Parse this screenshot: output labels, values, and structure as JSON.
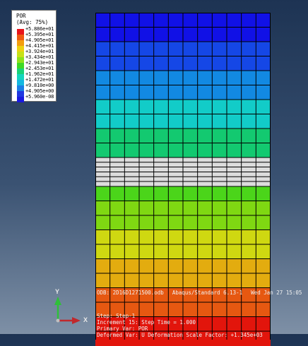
{
  "legend": {
    "title": "POR",
    "subtitle": "(Avg: 75%)",
    "entries": [
      {
        "label": "+5.886e+01",
        "color": "#e8141b"
      },
      {
        "label": "+5.395e+01",
        "color": "#ef5a12"
      },
      {
        "label": "+4.905e+01",
        "color": "#f39e0e"
      },
      {
        "label": "+4.415e+01",
        "color": "#ecd211"
      },
      {
        "label": "+3.924e+01",
        "color": "#c8e116"
      },
      {
        "label": "+3.434e+01",
        "color": "#8ee21b"
      },
      {
        "label": "+2.943e+01",
        "color": "#3ed924"
      },
      {
        "label": "+2.453e+01",
        "color": "#19d278"
      },
      {
        "label": "+1.962e+01",
        "color": "#14d5bd"
      },
      {
        "label": "+1.472e+01",
        "color": "#14b8e0"
      },
      {
        "label": "+9.810e+00",
        "color": "#1b7fe6"
      },
      {
        "label": "+4.905e+00",
        "color": "#1f38e0"
      },
      {
        "label": "+5.960e-08",
        "color": "#1a1adf"
      }
    ]
  },
  "contour": {
    "band_colors": [
      "#1111e6",
      "#1111e6",
      "#1547e6",
      "#1547e6",
      "#1289e2",
      "#1289e2",
      "#12ccc8",
      "#12ccc8",
      "#13c970",
      "#13c970",
      "#dcdcdc",
      "#dcdcdc",
      "#4bd51a",
      "#7fd812",
      "#7fd812",
      "#cfd811",
      "#cfd811",
      "#e3ac0f",
      "#e3ac0f",
      "#e65811",
      "#e65811",
      "#e2150c",
      "#e2150c"
    ],
    "columns": 12
  },
  "info": {
    "odb_file": "ODB: 2D16D1271500.odb",
    "solver": "Abaqus/Standard 6.13-1",
    "date": "Wed Jan 27 15:05",
    "step_line": "Step: Step-1",
    "increment_line": "Increment    15: Step Time =    1.000",
    "primary_var_line": "Primary Var: POR",
    "deformed_line": "Deformed Var: U   Deformation Scale Factor: +1.345e+03"
  },
  "triad": {
    "x_label": "X",
    "y_label": "Y",
    "x_color": "#c0282c",
    "y_color": "#2fbf3a"
  }
}
